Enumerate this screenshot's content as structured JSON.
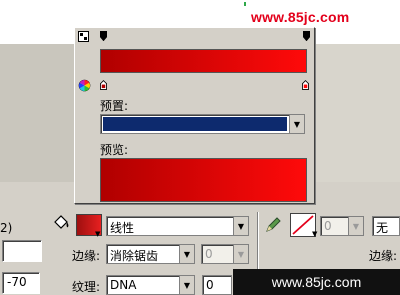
{
  "watermark": {
    "top": "www.85jc.com",
    "bottom": "www.85jc.com"
  },
  "popup": {
    "preset_label": "预置:",
    "preview_label": "预览:"
  },
  "properties": {
    "fill_type": "线性",
    "edge_label": "边缘:",
    "edge_value": "消除锯齿",
    "edge_amount": "0",
    "texture_label": "纹理:",
    "texture_value": "DNA",
    "texture_amount": "0",
    "left_partial": "2)",
    "left_value": "-70",
    "stroke_amount": "0",
    "stroke_type": "无",
    "edge_label_right": "边缘:"
  },
  "colors": {
    "ramp_left": "#b00000",
    "ramp_right": "#ff0a0a",
    "preset_swatch": "#0d2a6e",
    "accent": "#e3001b"
  },
  "icons": [
    "color-wheel-icon",
    "gradient-toggle-icon",
    "paint-bucket-icon",
    "pencil-icon",
    "chevron-down-icon"
  ]
}
